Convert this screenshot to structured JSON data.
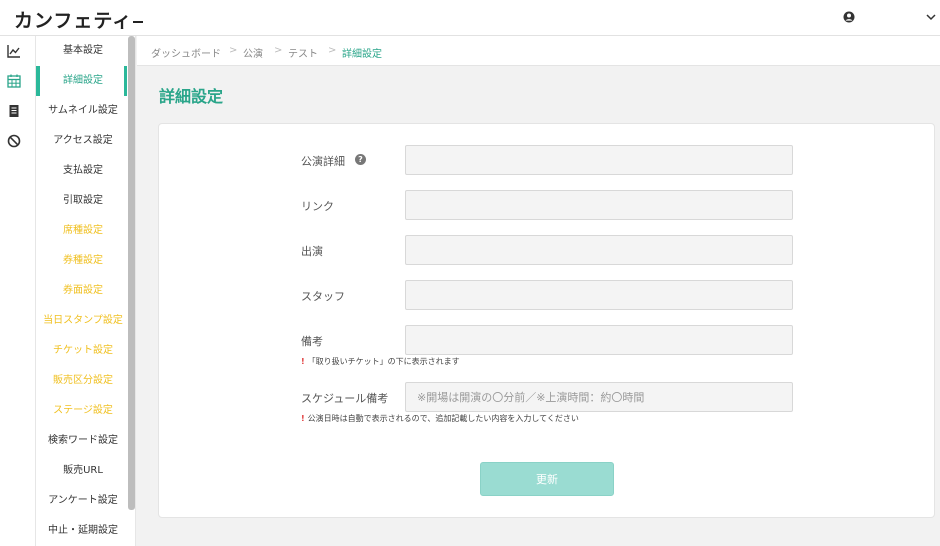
{
  "app": {
    "logo_text": "カンフェティ"
  },
  "header": {
    "user_icon": "user-circle-icon",
    "menu_icon": "chevron-down-icon"
  },
  "rail": {
    "icons": [
      "chart-line-icon",
      "calendar-icon",
      "document-icon",
      "ban-icon"
    ]
  },
  "submenu": {
    "items": [
      {
        "label": "基本設定",
        "state": "normal"
      },
      {
        "label": "詳細設定",
        "state": "active"
      },
      {
        "label": "サムネイル設定",
        "state": "normal"
      },
      {
        "label": "アクセス設定",
        "state": "normal"
      },
      {
        "label": "支払設定",
        "state": "normal"
      },
      {
        "label": "引取設定",
        "state": "normal"
      },
      {
        "label": "席種設定",
        "state": "yellow"
      },
      {
        "label": "券種設定",
        "state": "yellow"
      },
      {
        "label": "券面設定",
        "state": "yellow"
      },
      {
        "label": "当日スタンプ設定",
        "state": "yellow"
      },
      {
        "label": "チケット設定",
        "state": "yellow"
      },
      {
        "label": "販売区分設定",
        "state": "yellow"
      },
      {
        "label": "ステージ設定",
        "state": "yellow"
      },
      {
        "label": "検索ワード設定",
        "state": "normal"
      },
      {
        "label": "販売URL",
        "state": "normal"
      },
      {
        "label": "アンケート設定",
        "state": "normal"
      },
      {
        "label": "中止・延期設定",
        "state": "normal"
      }
    ]
  },
  "breadcrumb": {
    "items": [
      "ダッシュボード",
      "公演",
      "テスト",
      "詳細設定"
    ],
    "separator": ">"
  },
  "page": {
    "title": "詳細設定"
  },
  "form": {
    "fields": [
      {
        "label": "公演詳細",
        "value": "",
        "placeholder": "",
        "help": "?"
      },
      {
        "label": "リンク",
        "value": "",
        "placeholder": ""
      },
      {
        "label": "出演",
        "value": "",
        "placeholder": ""
      },
      {
        "label": "スタッフ",
        "value": "",
        "placeholder": ""
      },
      {
        "label": "備考",
        "value": "",
        "placeholder": "",
        "note": "「取り扱いチケット」の下に表示されます"
      },
      {
        "label": "スケジュール備考",
        "value": "",
        "placeholder": "※開場は開演の〇分前／※上演時間：約〇時間",
        "note": "公演日時は自動で表示されるので、追加記載したい内容を入力してください"
      }
    ],
    "note_mark": "!",
    "submit_label": "更新"
  },
  "colors": {
    "accent": "#2aa58a",
    "warning_text": "#f0c020",
    "button_bg": "#9adcd2",
    "note_mark": "#e03a3a"
  }
}
